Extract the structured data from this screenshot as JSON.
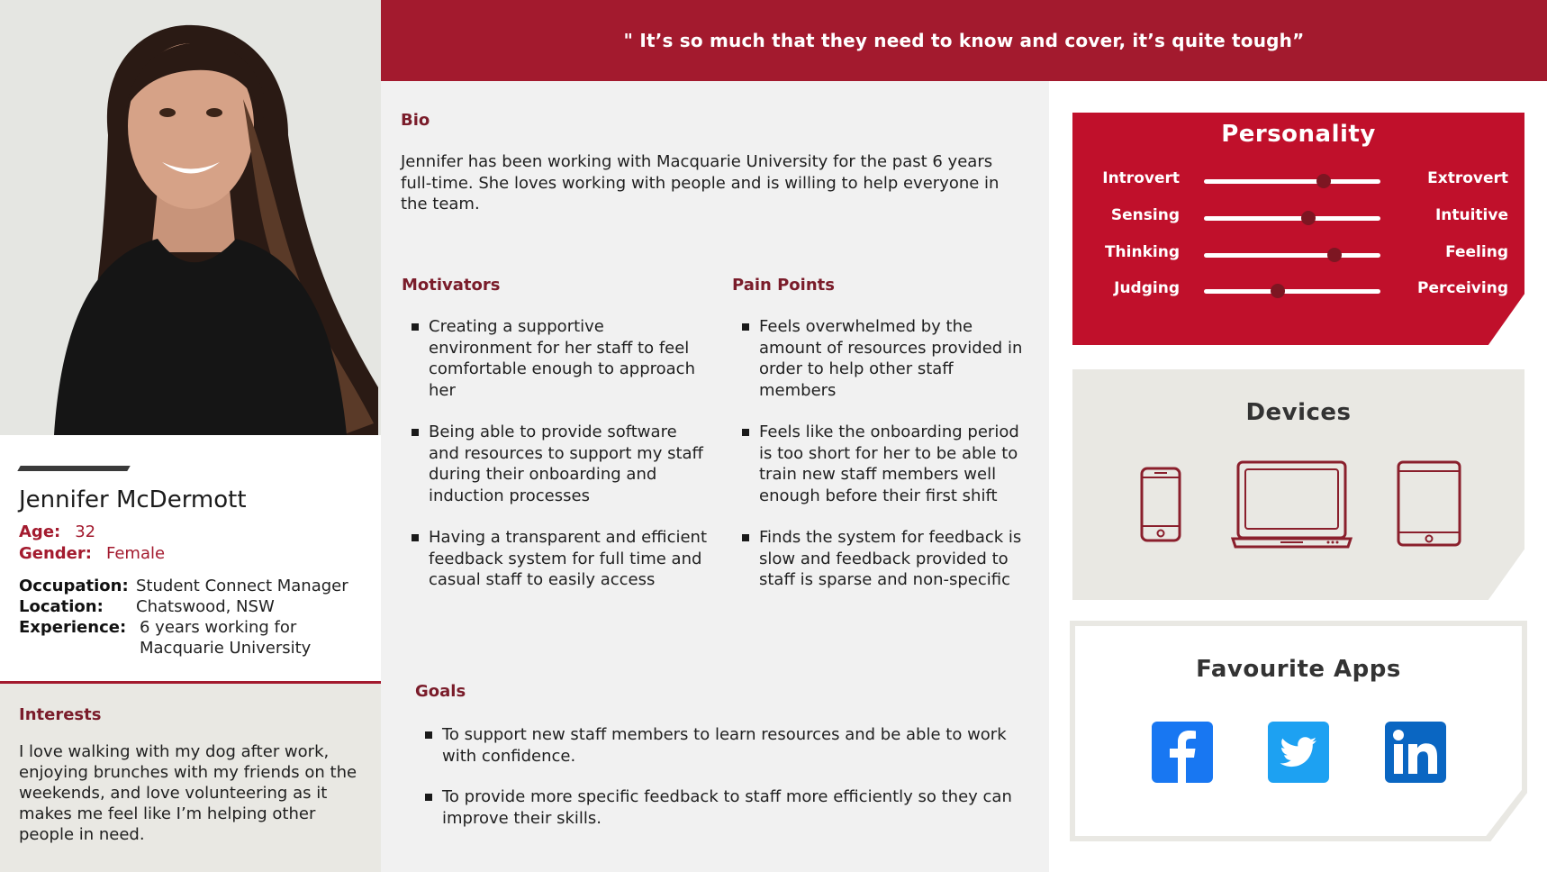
{
  "quote": "\" It’s so much that they need to know and cover, it’s quite tough”",
  "profile": {
    "name": "Jennifer McDermott",
    "age_label": "Age:",
    "age": "32",
    "gender_label": "Gender:",
    "gender": "Female",
    "occupation_label": "Occupation:",
    "occupation": "Student Connect Manager",
    "location_label": "Location:",
    "location": "Chatswood, NSW",
    "experience_label": "Experience:",
    "experience_line1": "6 years working for",
    "experience_line2": "Macquarie University"
  },
  "interests": {
    "title": "Interests",
    "text": "I love walking with my dog after work, enjoying brunches with my friends on the weekends, and love volunteering as it makes me feel like I’m helping other people in need."
  },
  "bio": {
    "title": "Bio",
    "text": "Jennifer has been working with Macquarie University for the past 6 years full-time. She loves working with people and is willing to help everyone in the team."
  },
  "motivators": {
    "title": "Motivators",
    "items": [
      "Creating a supportive environment for her staff to feel comfortable enough to approach her",
      "Being able to provide software and resources to support my staff during their onboarding and induction processes",
      "Having a transparent and efficient feedback system for full time and casual staff to easily access"
    ]
  },
  "pain_points": {
    "title": "Pain Points",
    "items": [
      "Feels overwhelmed by the amount of resources provided in order to help other staff members",
      "Feels like the onboarding period is too short for her to be able to train new staff members well enough before their first shift",
      "Finds the system for feedback is slow and feedback provided to staff is sparse and non-specific"
    ]
  },
  "goals": {
    "title": "Goals",
    "items": [
      "To support new staff members to learn resources and be able to work with confidence.",
      "To provide more specific feedback to staff more efficiently so they can improve their skills."
    ]
  },
  "personality": {
    "title": "Personality",
    "traits": [
      {
        "left": "Introvert",
        "right": "Extrovert",
        "value": 0.68
      },
      {
        "left": "Sensing",
        "right": "Intuitive",
        "value": 0.59
      },
      {
        "left": "Thinking",
        "right": "Feeling",
        "value": 0.74
      },
      {
        "left": "Judging",
        "right": "Perceiving",
        "value": 0.42
      }
    ]
  },
  "devices": {
    "title": "Devices",
    "items": [
      "phone-icon",
      "laptop-icon",
      "tablet-icon"
    ]
  },
  "favourite_apps": {
    "title": "Favourite Apps",
    "items": [
      "facebook-icon",
      "twitter-icon",
      "linkedin-icon"
    ]
  },
  "colors": {
    "brand_red": "#a31a2e",
    "personality_red": "#c0102b",
    "device_stroke": "#8a1f2c",
    "app_blue": "#1877f2",
    "twitter_blue": "#1da1f2",
    "linkedin_blue": "#0a66c2"
  }
}
